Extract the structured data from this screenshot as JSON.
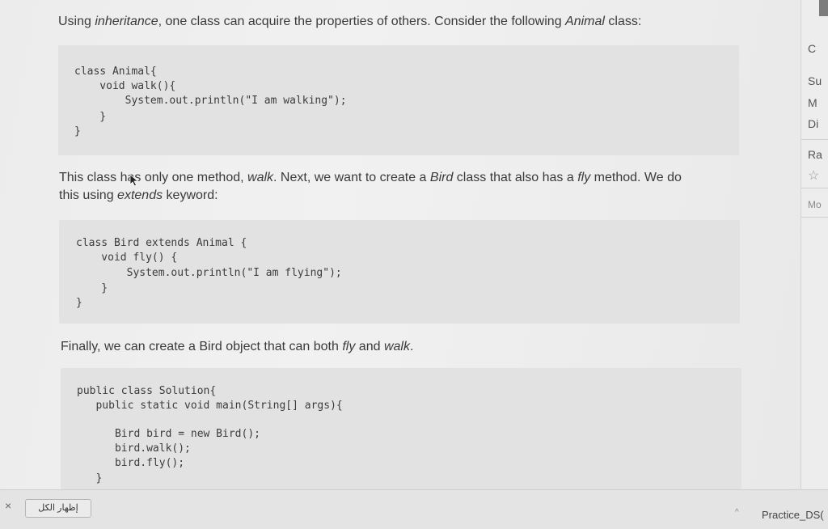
{
  "intro": {
    "t1": "Using ",
    "e1": "inheritance",
    "t2": ", one class can acquire the properties of others. Consider the following ",
    "e2": "Animal",
    "t3": " class:"
  },
  "code1": [
    "class Animal{",
    "    void walk(){",
    "        System.out.println(\"I am walking\");",
    "    }",
    "}"
  ],
  "para2": {
    "t1": "This class has only one method, ",
    "e1": "walk",
    "t2": ". Next, we want to create a ",
    "e2": "Bird",
    "t3": " class that also has a ",
    "e3": "fly",
    "t4": " method. We do",
    "t5": "this using ",
    "e4": "extends",
    "t6": " keyword:"
  },
  "code2": [
    "class Bird extends Animal {",
    "    void fly() {",
    "        System.out.println(\"I am flying\");",
    "    }",
    "}"
  ],
  "para3": {
    "t1": "Finally, we can create a Bird object that can both ",
    "e1": "fly",
    "t2": " and ",
    "e2": "walk",
    "t3": "."
  },
  "code3": [
    "public class Solution{",
    "   public static void main(String[] args){",
    "",
    "      Bird bird = new Bird();",
    "      bird.walk();",
    "      bird.fly();",
    "   }"
  ],
  "right_panel": {
    "items": [
      "C",
      "Su",
      "M",
      "Di",
      "Ra",
      "☆",
      "Mo"
    ]
  },
  "bottom_bar": {
    "close": "×",
    "show_all": "إظهار الكل",
    "caret": "^",
    "download": "Practice_DS("
  }
}
